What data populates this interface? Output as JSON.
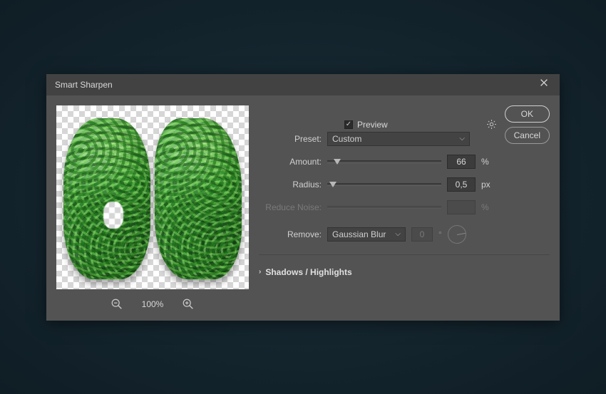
{
  "titlebar": {
    "title": "Smart Sharpen"
  },
  "preview": {
    "checkbox_label": "Preview",
    "checked": true
  },
  "buttons": {
    "ok": "OK",
    "cancel": "Cancel"
  },
  "zoom": {
    "level": "100%"
  },
  "preset": {
    "label": "Preset:",
    "value": "Custom"
  },
  "amount": {
    "label": "Amount:",
    "value": "66",
    "unit": "%",
    "slider_percent": 9
  },
  "radius": {
    "label": "Radius:",
    "value": "0,5",
    "unit": "px",
    "slider_percent": 5
  },
  "reduce_noise": {
    "label": "Reduce Noise:",
    "value": "",
    "unit": "%",
    "slider_percent": 0
  },
  "remove": {
    "label": "Remove:",
    "value": "Gaussian Blur",
    "angle": "0",
    "degree": "°"
  },
  "section": {
    "shadows_highlights": "Shadows / Highlights"
  }
}
